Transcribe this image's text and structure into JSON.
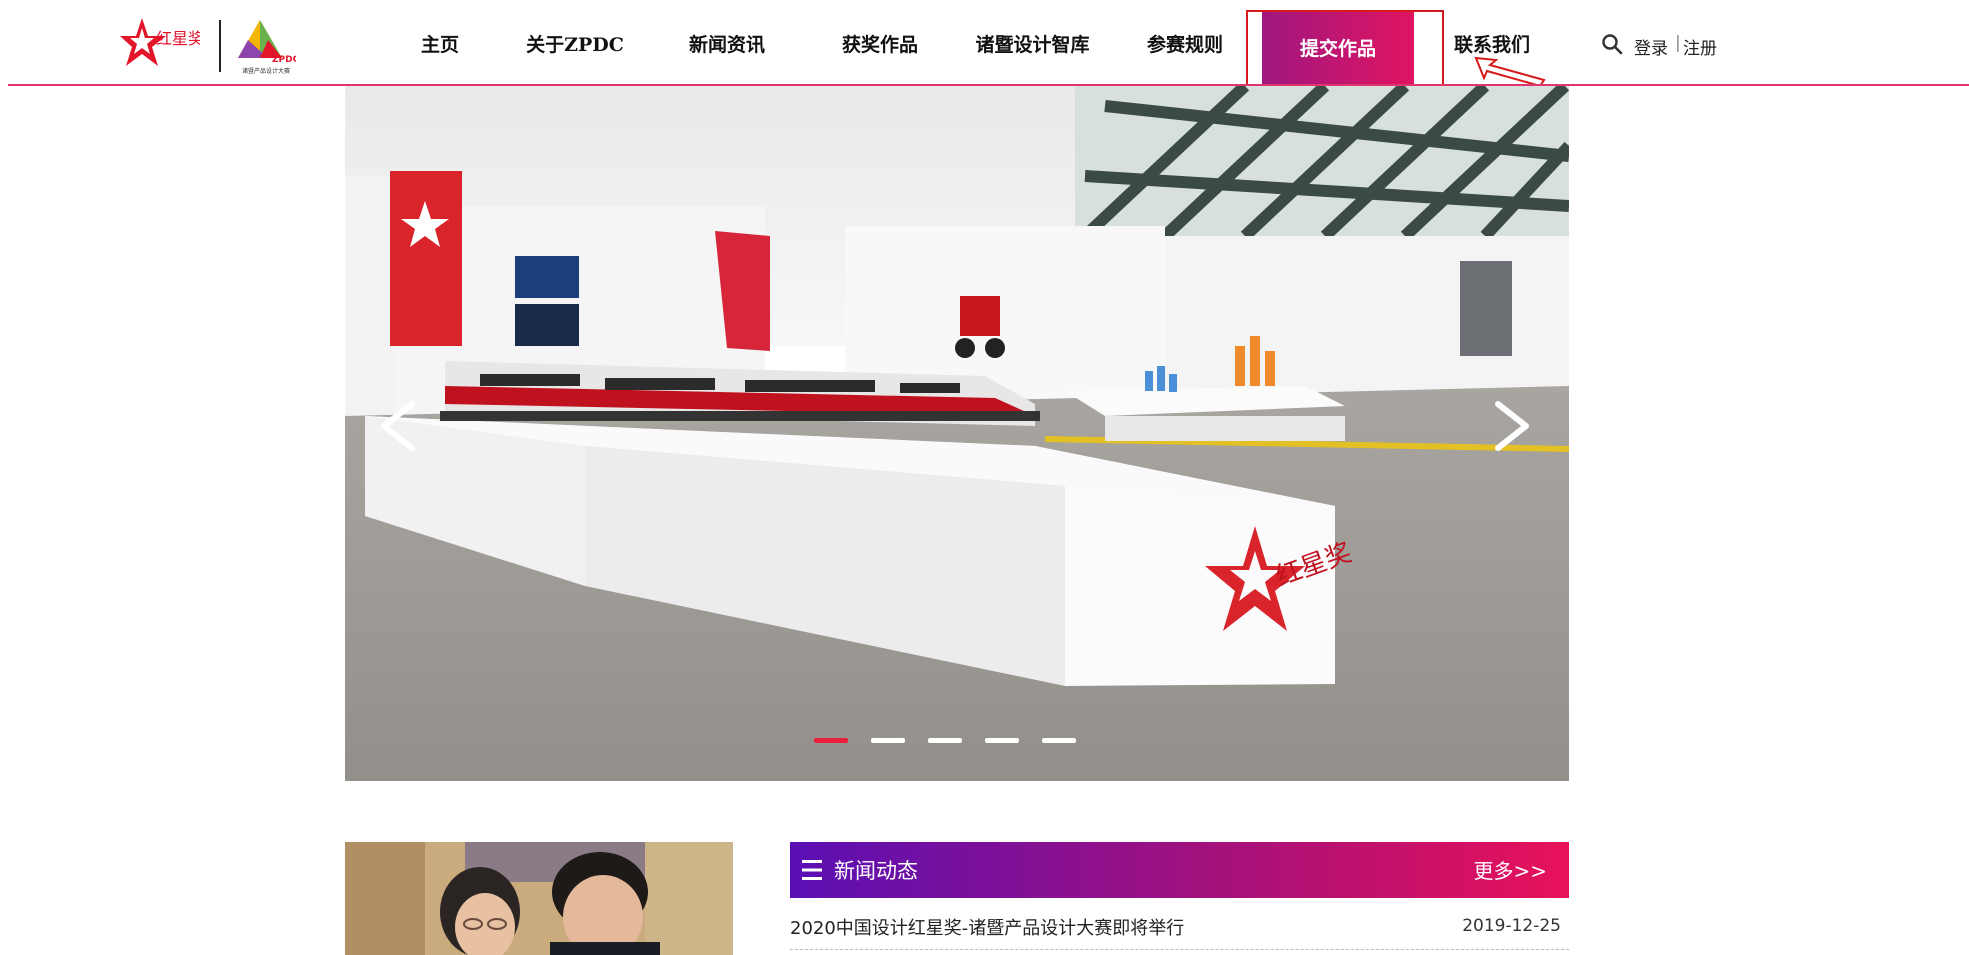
{
  "brand": {
    "logo_primary_text": "红星奖",
    "logo_secondary_text": "ZPDC",
    "logo_secondary_caption": "诸暨产品设计大赛"
  },
  "nav": {
    "items": [
      {
        "label": "主页"
      },
      {
        "label": "关于ZPDC"
      },
      {
        "label": "新闻资讯"
      },
      {
        "label": "获奖作品"
      },
      {
        "label": "诸暨设计智库"
      },
      {
        "label": "参赛规则"
      },
      {
        "label": "提交作品"
      },
      {
        "label": "联系我们"
      }
    ],
    "active_index": 6
  },
  "auth": {
    "login_label": "登录",
    "separator": "|",
    "register_label": "注册"
  },
  "banner": {
    "prev_icon": "chevron-left-icon",
    "next_icon": "chevron-right-icon",
    "slide_count": 5,
    "active_slide": 1,
    "exhibit_sign_text": "红星奖"
  },
  "news": {
    "title": "新闻动态",
    "more_label": "更多>>",
    "items": [
      {
        "title": "2020中国设计红星奖-诸暨产品设计大赛即将举行",
        "date": "2019-12-25"
      }
    ]
  },
  "colors": {
    "accent_start": "#a0177f",
    "accent_end": "#e01462",
    "header_line": "#e0356e",
    "dot_active": "#e8203c"
  }
}
